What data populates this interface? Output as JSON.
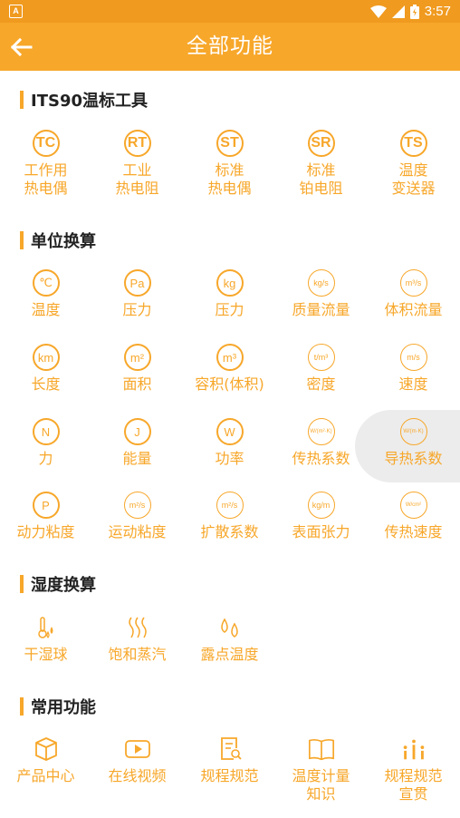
{
  "status_bar": {
    "time": "3:57",
    "notification_icon": "A"
  },
  "app_bar": {
    "title": "全部功能"
  },
  "sections": {
    "its90": {
      "title": "ITS90温标工具",
      "items": [
        {
          "badge": "TC",
          "label1": "工作用",
          "label2": "热电偶"
        },
        {
          "badge": "RT",
          "label1": "工业",
          "label2": "热电阻"
        },
        {
          "badge": "ST",
          "label1": "标准",
          "label2": "热电偶"
        },
        {
          "badge": "SR",
          "label1": "标准",
          "label2": "铂电阻"
        },
        {
          "badge": "TS",
          "label1": "温度",
          "label2": "变送器"
        }
      ]
    },
    "units": {
      "title": "单位换算",
      "items": [
        {
          "badge": "℃",
          "label": "温度"
        },
        {
          "badge": "Pa",
          "label": "压力"
        },
        {
          "badge": "kg",
          "label": "压力"
        },
        {
          "badge": "kg/s",
          "label": "质量流量"
        },
        {
          "badge": "m³/s",
          "label": "体积流量"
        },
        {
          "badge": "km",
          "label": "长度"
        },
        {
          "badge": "m²",
          "label": "面积"
        },
        {
          "badge": "m³",
          "label": "容积(体积)"
        },
        {
          "badge": "t/m³",
          "label": "密度"
        },
        {
          "badge": "m/s",
          "label": "速度"
        },
        {
          "badge": "N",
          "label": "力"
        },
        {
          "badge": "J",
          "label": "能量"
        },
        {
          "badge": "W",
          "label": "功率"
        },
        {
          "badge": "W/(m²·K)",
          "label": "传热系数"
        },
        {
          "badge": "W/(m·K)",
          "label": "导热系数"
        },
        {
          "badge": "P",
          "label": "动力粘度"
        },
        {
          "badge": "m²/s",
          "label": "运动粘度"
        },
        {
          "badge": "m²/s",
          "label": "扩散系数"
        },
        {
          "badge": "kg/m",
          "label": "表面张力"
        },
        {
          "badge": "W/cm²",
          "label": "传热速度"
        }
      ]
    },
    "humidity": {
      "title": "湿度换算",
      "items": [
        {
          "icon": "thermometer-drop-icon",
          "label": "干湿球"
        },
        {
          "icon": "steam-icon",
          "label": "饱和蒸汽"
        },
        {
          "icon": "dew-drops-icon",
          "label": "露点温度"
        }
      ]
    },
    "common": {
      "title": "常用功能",
      "items": [
        {
          "icon": "box-icon",
          "label1": "产品中心",
          "label2": ""
        },
        {
          "icon": "video-icon",
          "label1": "在线视频",
          "label2": ""
        },
        {
          "icon": "document-search-icon",
          "label1": "规程规范",
          "label2": ""
        },
        {
          "icon": "open-book-icon",
          "label1": "温度计量",
          "label2": "知识"
        },
        {
          "icon": "people-icon",
          "label1": "规程规范",
          "label2": "宣贯"
        }
      ]
    }
  },
  "colors": {
    "accent": "#f7a72a",
    "status_bar": "#f09a1f",
    "highlight": "#ececec"
  }
}
